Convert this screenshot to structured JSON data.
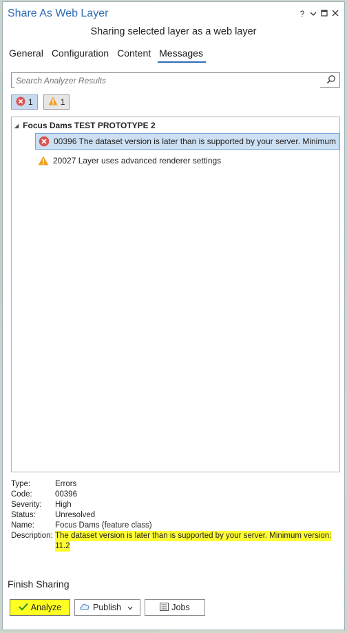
{
  "window": {
    "title": "Share As Web Layer",
    "subtitle": "Sharing selected layer as a web layer",
    "controls": {
      "help": "?",
      "menu": "⌄",
      "pin": "✕"
    }
  },
  "tabs": [
    {
      "label": "General",
      "active": false
    },
    {
      "label": "Configuration",
      "active": false
    },
    {
      "label": "Content",
      "active": false
    },
    {
      "label": "Messages",
      "active": true
    }
  ],
  "search": {
    "placeholder": "Search Analyzer Results",
    "icon": "search-icon"
  },
  "filters": {
    "errors_count": "1",
    "warnings_count": "1"
  },
  "results": {
    "group_label": "Focus Dams TEST PROTOTYPE 2",
    "items": [
      {
        "type": "error",
        "text": "00396 The dataset version is later than is supported by your server. Minimum",
        "selected": true
      },
      {
        "type": "warning",
        "text": "20027 Layer uses advanced renderer settings",
        "selected": false
      }
    ]
  },
  "details": {
    "type_label": "Type:",
    "type_value": "Errors",
    "code_label": "Code:",
    "code_value": "00396",
    "severity_label": "Severity:",
    "severity_value": "High",
    "status_label": "Status:",
    "status_value": "Unresolved",
    "name_label": "Name:",
    "name_value": "Focus Dams (feature class)",
    "description_label": "Description:",
    "description_line1": "The dataset version is later than is supported by your server. Minimum version:",
    "description_line2": "11.2"
  },
  "finish": {
    "heading": "Finish Sharing",
    "analyze_label": "Analyze",
    "publish_label": "Publish",
    "jobs_label": "Jobs"
  },
  "colors": {
    "accent": "#2f6db5",
    "highlight": "#ffff33",
    "error": "#d9534f",
    "warning": "#f0a020"
  }
}
